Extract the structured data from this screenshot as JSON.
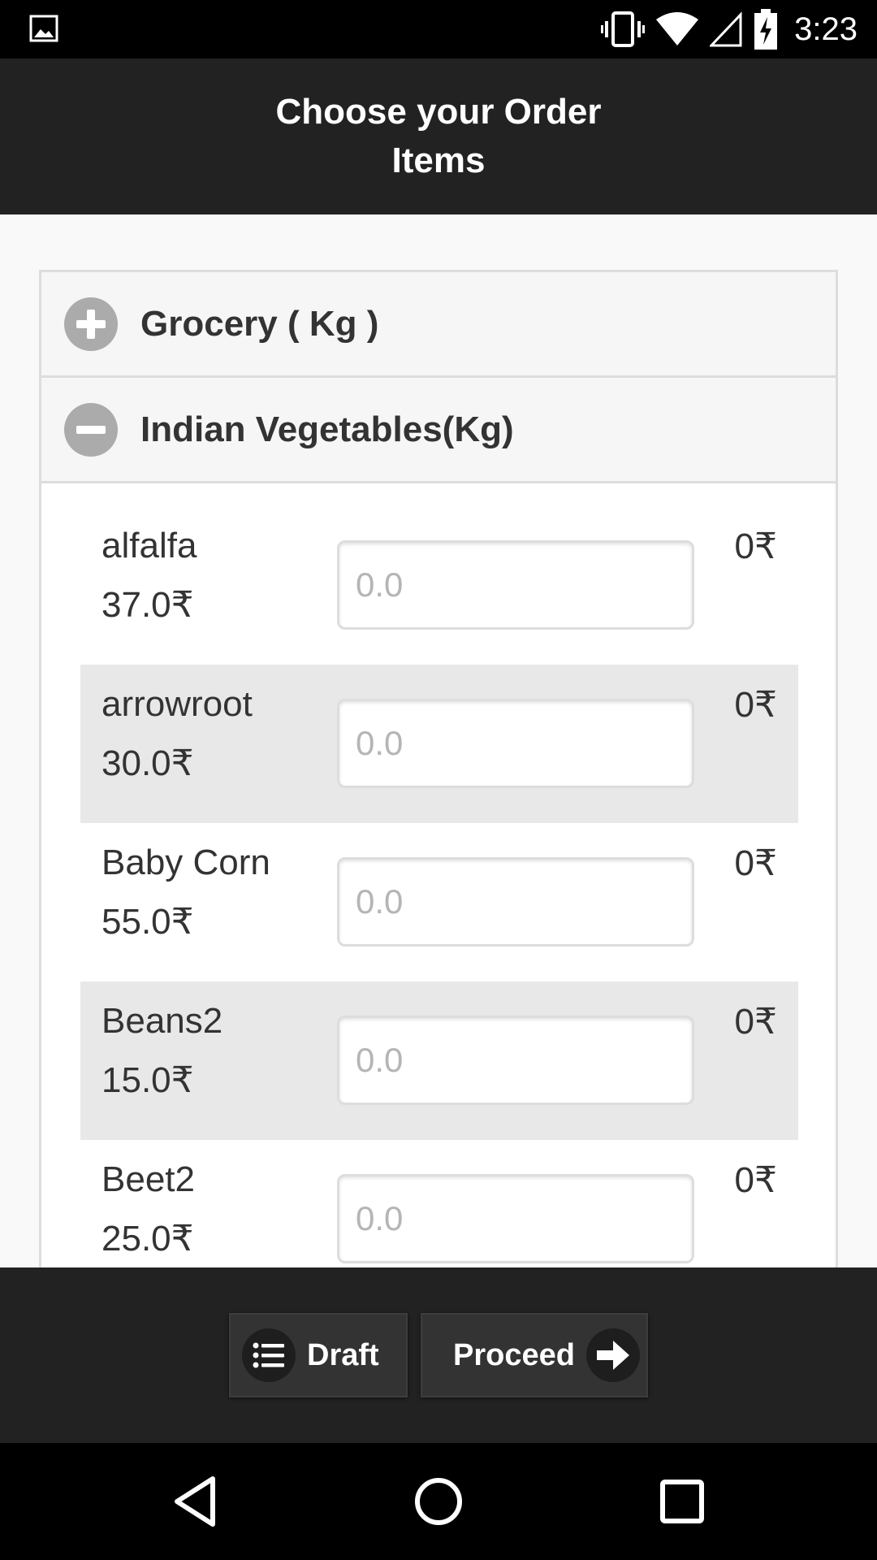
{
  "status_bar": {
    "time": "3:23",
    "icons": [
      "image-icon",
      "vibrate-icon",
      "wifi-icon",
      "signal-icon",
      "battery-charging-icon"
    ]
  },
  "header": {
    "title": "Choose your Order Items"
  },
  "categories": [
    {
      "label": "Grocery ( Kg )",
      "icon": "plus-circle-icon",
      "expanded": false
    },
    {
      "label": "Indian Vegetables(Kg)",
      "icon": "minus-circle-icon",
      "expanded": true
    }
  ],
  "items": [
    {
      "name": "alfalfa",
      "price": "37.0₹",
      "placeholder": "0.0",
      "total": "0₹"
    },
    {
      "name": "arrowroot",
      "price": "30.0₹",
      "placeholder": "0.0",
      "total": "0₹"
    },
    {
      "name": "Baby Corn",
      "price": "55.0₹",
      "placeholder": "0.0",
      "total": "0₹"
    },
    {
      "name": "Beans2",
      "price": "15.0₹",
      "placeholder": "0.0",
      "total": "0₹"
    },
    {
      "name": "Beet2",
      "price": "25.0₹",
      "placeholder": "0.0",
      "total": "0₹"
    }
  ],
  "footer": {
    "draft_label": "Draft",
    "draft_icon": "list-icon",
    "proceed_label": "Proceed",
    "proceed_icon": "arrow-right-icon"
  },
  "nav_bar": {
    "icons": [
      "back-icon",
      "home-icon",
      "recents-icon"
    ]
  },
  "colors": {
    "header_bg": "#222222",
    "accent_icon": "#ababab",
    "row_alt": "#e8e8e8"
  }
}
